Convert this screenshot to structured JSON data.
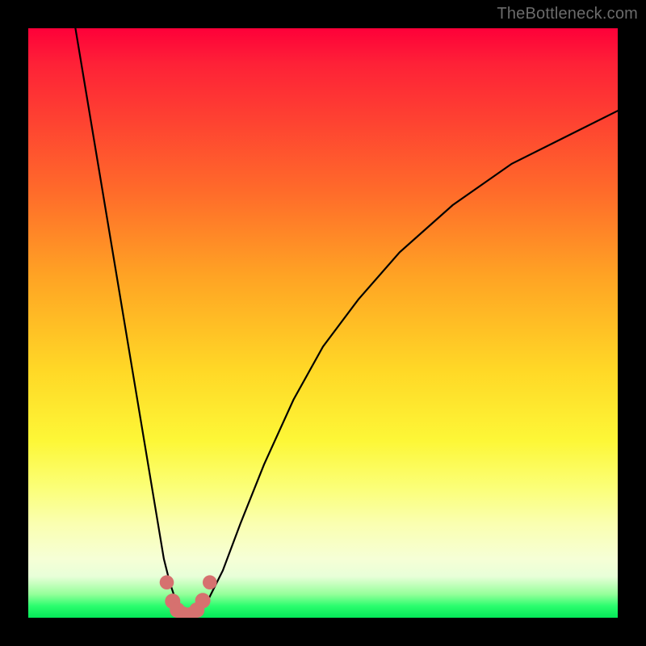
{
  "watermark": "TheBottleneck.com",
  "chart_data": {
    "type": "line",
    "title": "",
    "xlabel": "",
    "ylabel": "",
    "xlim": [
      0,
      100
    ],
    "ylim": [
      0,
      100
    ],
    "grid": false,
    "legend": false,
    "series": [
      {
        "name": "bottleneck-curve",
        "x": [
          8,
          10,
          12,
          14,
          16,
          18,
          20,
          22,
          23,
          24,
          25,
          26,
          27,
          28,
          29,
          30,
          31,
          33,
          36,
          40,
          45,
          50,
          56,
          63,
          72,
          82,
          92,
          100
        ],
        "y": [
          100,
          88,
          76,
          64,
          52,
          40,
          28,
          16,
          10,
          6,
          3,
          1,
          0,
          0,
          1,
          2,
          4,
          8,
          16,
          26,
          37,
          46,
          54,
          62,
          70,
          77,
          82,
          86
        ]
      }
    ],
    "markers": {
      "name": "highlighted-points",
      "color": "#d6716f",
      "points": [
        {
          "x": 23.5,
          "y": 6.0,
          "r": 1.2
        },
        {
          "x": 24.5,
          "y": 2.8,
          "r": 1.3
        },
        {
          "x": 25.3,
          "y": 1.3,
          "r": 1.3
        },
        {
          "x": 26.3,
          "y": 0.6,
          "r": 1.3
        },
        {
          "x": 27.5,
          "y": 0.5,
          "r": 1.3
        },
        {
          "x": 28.6,
          "y": 1.3,
          "r": 1.3
        },
        {
          "x": 29.6,
          "y": 2.9,
          "r": 1.3
        },
        {
          "x": 30.8,
          "y": 6.0,
          "r": 1.2
        }
      ]
    },
    "annotations": []
  }
}
